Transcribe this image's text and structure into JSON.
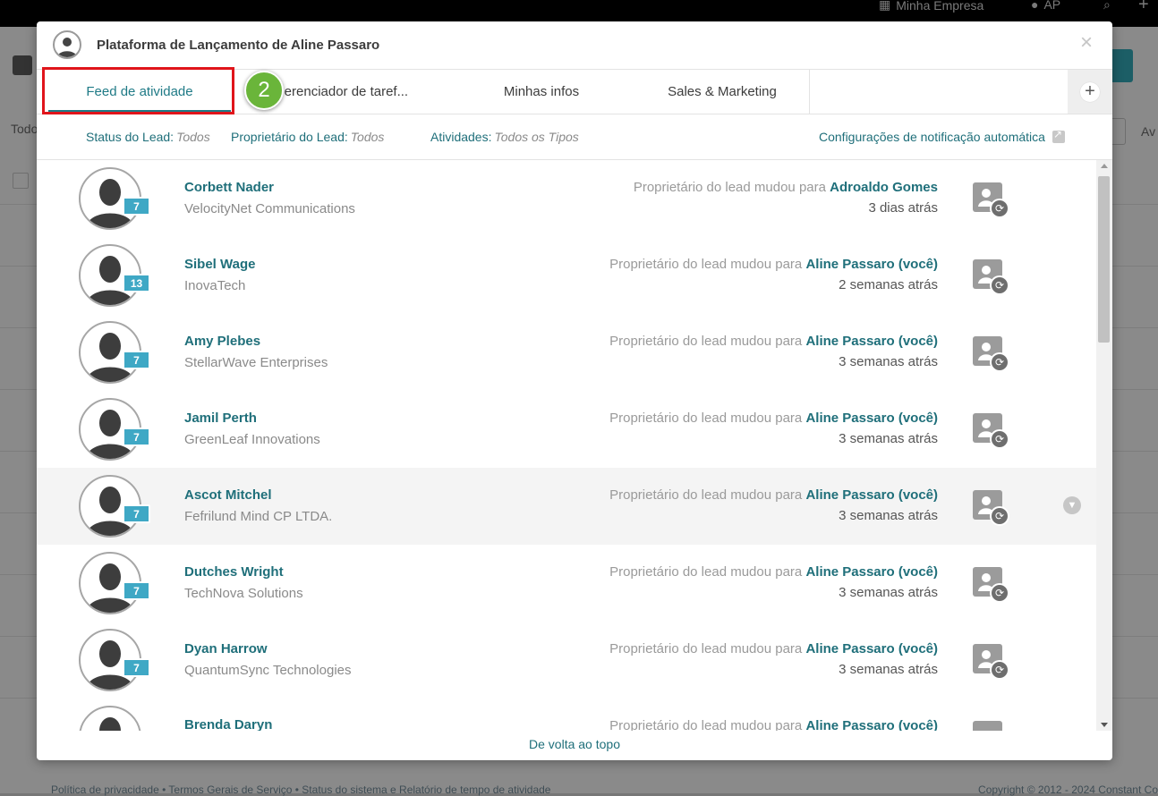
{
  "background": {
    "company_label": "Minha Empresa",
    "user_initials": "AP",
    "left_label": "Todo",
    "right_label": "Av",
    "footer_left": "Política de privacidade • Termos Gerais de Serviço • Status do sistema e Relatório de tempo de atividade",
    "footer_right": "Copyright © 2012 - 2024 Constant Co"
  },
  "modal": {
    "title": "Plataforma de Lançamento de Aline Passaro",
    "close_glyph": "×",
    "tabs": [
      {
        "label": "Feed de atividade",
        "active": true
      },
      {
        "label": "Gerenciador de taref..."
      },
      {
        "label": "Minhas infos"
      },
      {
        "label": "Sales & Marketing"
      }
    ],
    "add_tab_glyph": "+",
    "step_badge": "2",
    "filters": {
      "status_key": "Status do Lead:",
      "status_value": "Todos",
      "owner_key": "Proprietário do Lead:",
      "owner_value": "Todos",
      "activities_key": "Atividades:",
      "activities_value": "Todos os Tipos",
      "notification_link": "Configurações de notificação automática"
    },
    "feed": [
      {
        "name": "Corbett Nader",
        "company": "VelocityNet Communications",
        "count": "7",
        "message": "Proprietário do lead mudou para",
        "target": "Adroaldo Gomes",
        "time": "3 dias atrás"
      },
      {
        "name": "Sibel Wage",
        "company": "InovaTech",
        "count": "13",
        "message": "Proprietário do lead mudou para",
        "target": "Aline Passaro (você)",
        "time": "2 semanas atrás"
      },
      {
        "name": "Amy Plebes",
        "company": "StellarWave Enterprises",
        "count": "7",
        "message": "Proprietário do lead mudou para",
        "target": "Aline Passaro (você)",
        "time": "3 semanas atrás"
      },
      {
        "name": "Jamil Perth",
        "company": "GreenLeaf Innovations",
        "count": "7",
        "message": "Proprietário do lead mudou para",
        "target": "Aline Passaro (você)",
        "time": "3 semanas atrás"
      },
      {
        "name": "Ascot Mitchel",
        "company": "Fefrilund Mind CP LTDA.",
        "count": "7",
        "message": "Proprietário do lead mudou para",
        "target": "Aline Passaro (você)",
        "time": "3 semanas atrás",
        "highlighted": true
      },
      {
        "name": "Dutches Wright",
        "company": "TechNova Solutions",
        "count": "7",
        "message": "Proprietário do lead mudou para",
        "target": "Aline Passaro (você)",
        "time": "3 semanas atrás"
      },
      {
        "name": "Dyan Harrow",
        "company": "QuantumSync Technologies",
        "count": "7",
        "message": "Proprietário do lead mudou para",
        "target": "Aline Passaro (você)",
        "time": "3 semanas atrás"
      },
      {
        "name": "Brenda Daryn",
        "company": "",
        "count": "",
        "message": "Proprietário do lead mudou para",
        "target": "Aline Passaro (você)",
        "time": ""
      }
    ],
    "back_to_top": "De volta ao topo"
  },
  "colors": {
    "accent": "#1f7a86",
    "badge": "#3fa8c5",
    "highlight_border": "#e0151b",
    "step_badge": "#6ab53a"
  }
}
